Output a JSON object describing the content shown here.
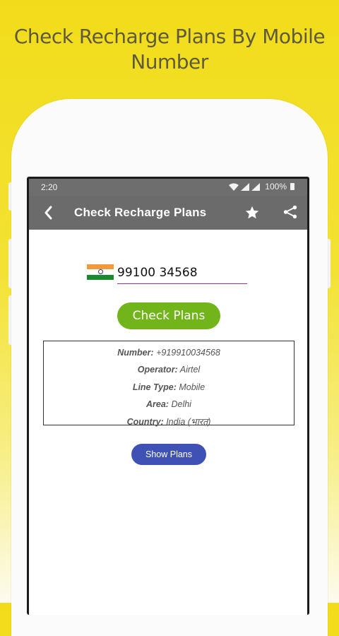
{
  "promo": {
    "headline": "Check Recharge Plans By Mobile Number"
  },
  "status_bar": {
    "time": "2:20",
    "battery": "100%",
    "icons": [
      "wifi-icon",
      "signal-icon",
      "signal-icon",
      "battery-icon"
    ]
  },
  "app_bar": {
    "title": "Check Recharge Plans",
    "back_icon": "back-arrow-icon",
    "favorite_icon": "star-icon",
    "share_icon": "share-icon"
  },
  "form": {
    "country_flag": "india-flag-icon",
    "phone_number": "99100 34568",
    "check_button": "Check Plans"
  },
  "result": {
    "number_label": "Number:",
    "number_value": "+919910034568",
    "operator_label": "Operator:",
    "operator_value": "Airtel",
    "line_type_label": "Line Type:",
    "line_type_value": "Mobile",
    "area_label": "Area:",
    "area_value": "Delhi",
    "country_label": "Country:",
    "country_value": "India (भारत)"
  },
  "show_plans_button": "Show Plans",
  "colors": {
    "background_top": "#f2dc1a",
    "app_bar": "#6b6b6b",
    "check_button": "#71b51b",
    "show_plans_button": "#3f51b5",
    "input_underline": "#b2278a"
  }
}
